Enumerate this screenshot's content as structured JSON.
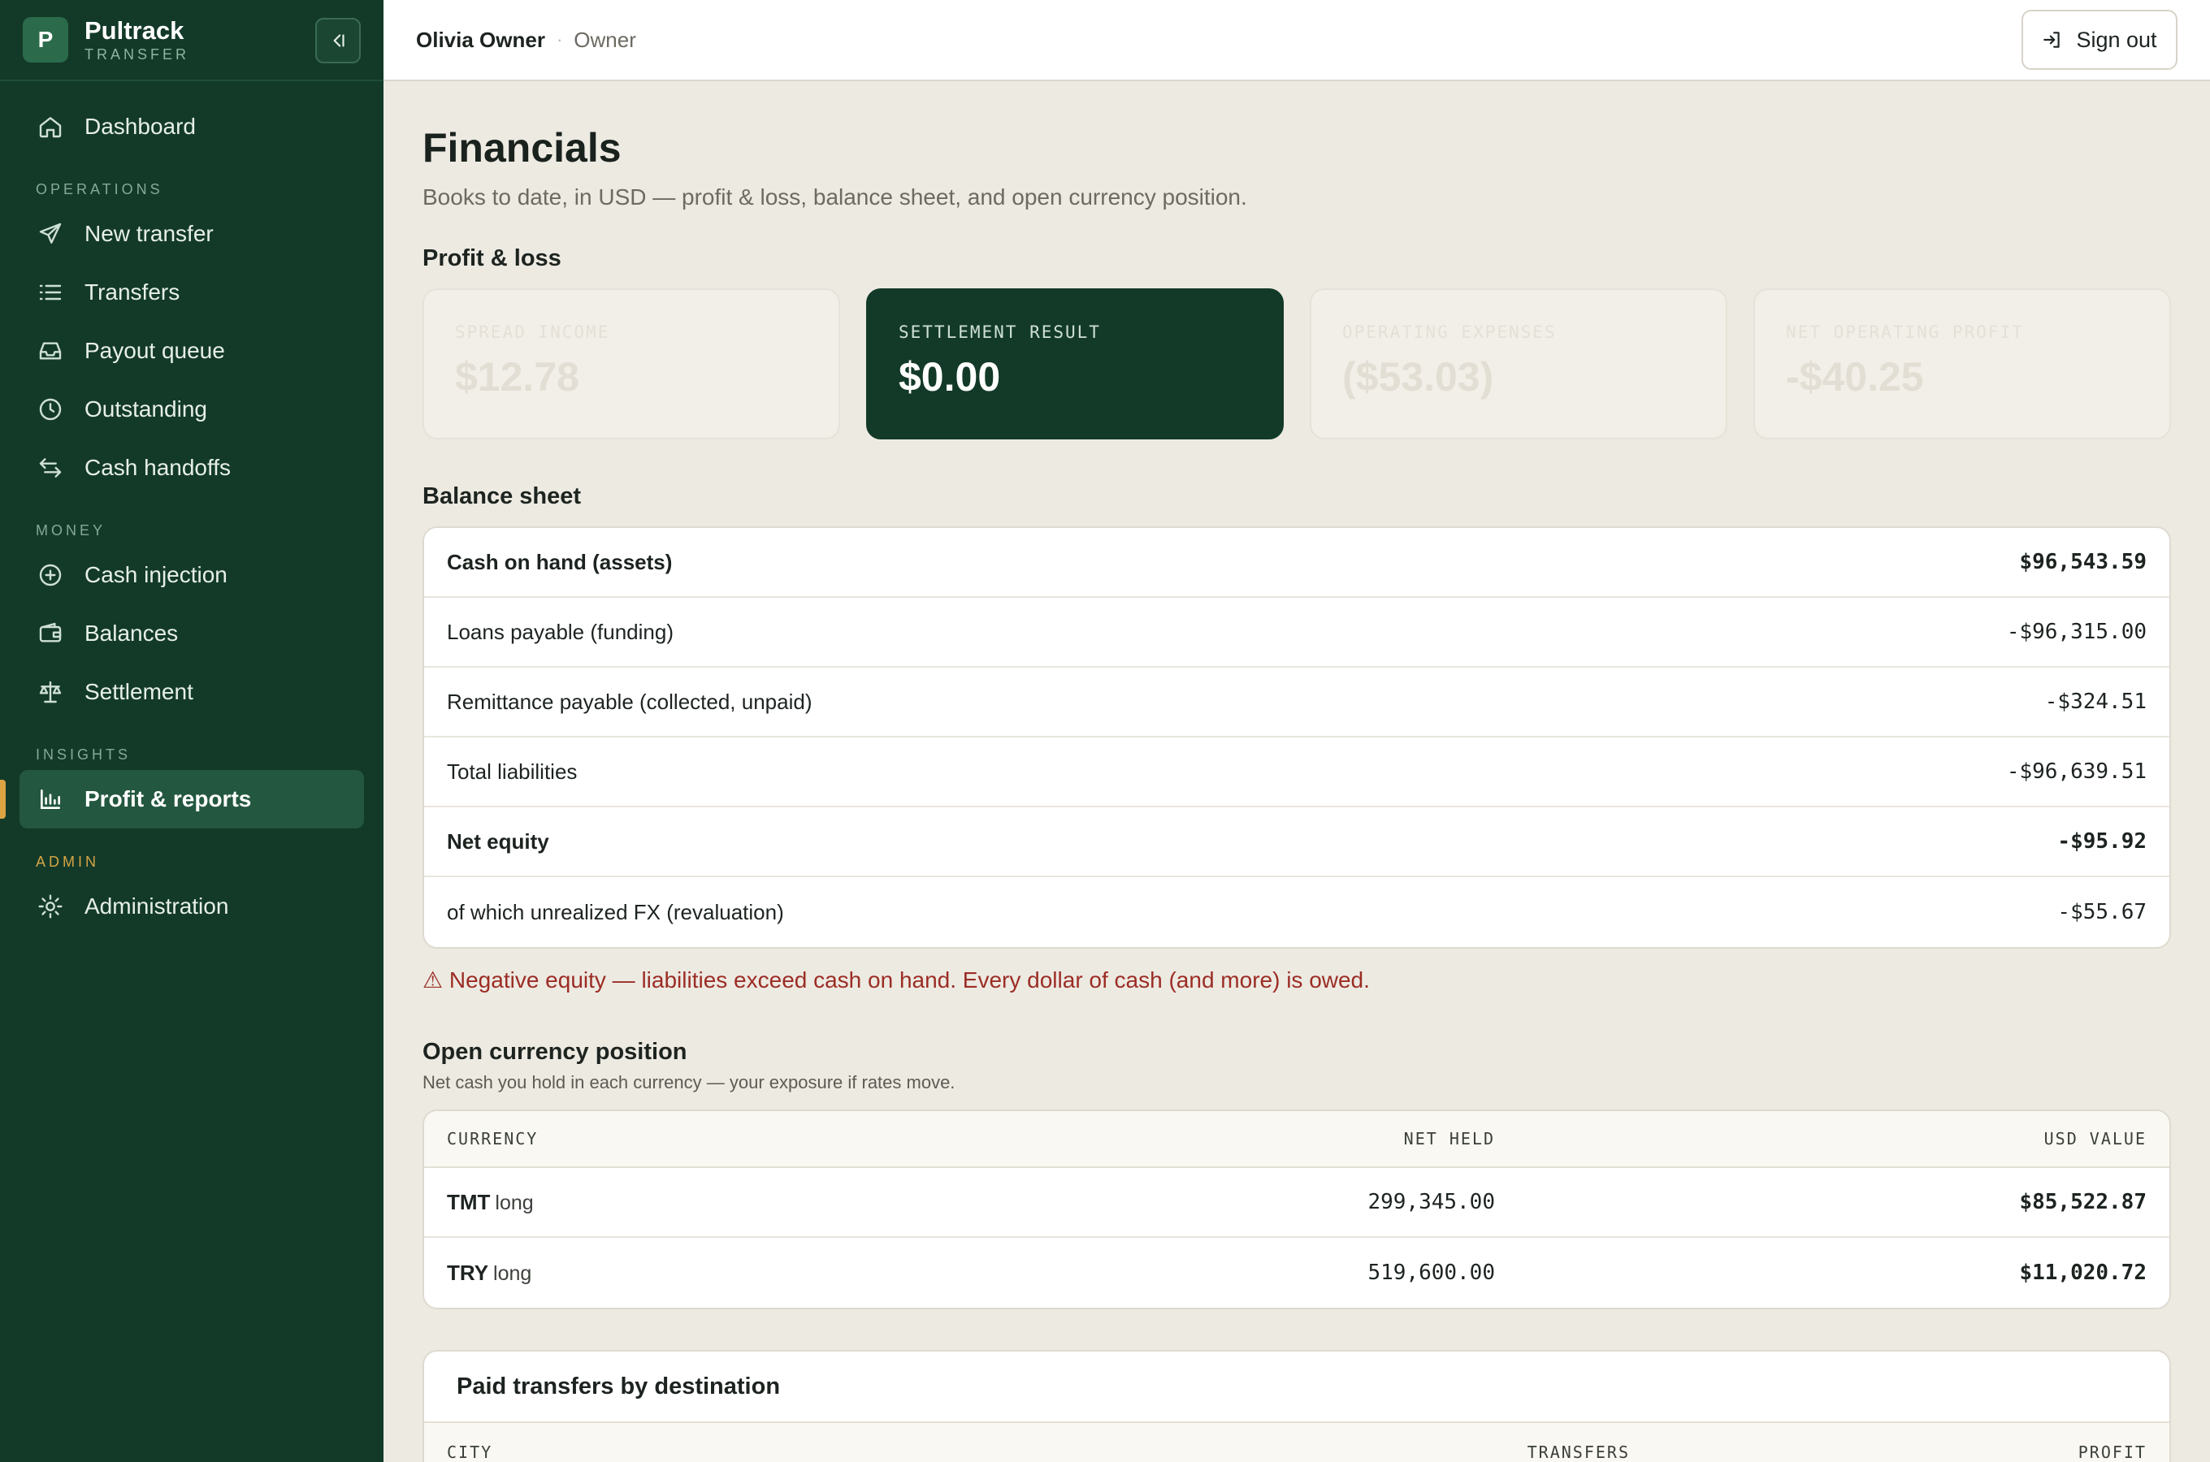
{
  "brand": {
    "logo_letter": "P",
    "name": "Pultrack",
    "sub": "TRANSFER"
  },
  "nav": {
    "dashboard": "Dashboard",
    "sections": {
      "operations": "OPERATIONS",
      "money": "MONEY",
      "insights": "INSIGHTS",
      "admin": "ADMIN"
    },
    "operations": [
      "New transfer",
      "Transfers",
      "Payout queue",
      "Outstanding",
      "Cash handoffs"
    ],
    "money": [
      "Cash injection",
      "Balances",
      "Settlement"
    ],
    "insights": [
      "Profit & reports"
    ],
    "admin": [
      "Administration"
    ]
  },
  "topbar": {
    "user": "Olivia Owner",
    "separator": "·",
    "role": "Owner",
    "signout": "Sign out"
  },
  "page": {
    "title": "Financials",
    "subtitle": "Books to date, in USD — profit & loss, balance sheet, and open currency position."
  },
  "pnl": {
    "title": "Profit & loss",
    "cards": [
      {
        "label": "SPREAD INCOME",
        "value": "$12.78"
      },
      {
        "label": "SETTLEMENT RESULT",
        "value": "$0.00"
      },
      {
        "label": "OPERATING EXPENSES",
        "value": "($53.03)"
      },
      {
        "label": "NET OPERATING PROFIT",
        "value": "-$40.25"
      }
    ]
  },
  "balance_sheet": {
    "title": "Balance sheet",
    "rows": [
      {
        "label": "Cash on hand (assets)",
        "value": "$96,543.59"
      },
      {
        "label": "Loans payable (funding)",
        "value": "-$96,315.00"
      },
      {
        "label": "Remittance payable (collected, unpaid)",
        "value": "-$324.51"
      },
      {
        "label": "Total liabilities",
        "value": "-$96,639.51"
      },
      {
        "label": "Net equity",
        "value": "-$95.92"
      },
      {
        "label": "of which unrealized FX (revaluation)",
        "value": "-$55.67"
      }
    ],
    "warning": "⚠ Negative equity — liabilities exceed cash on hand. Every dollar of cash (and more) is owed."
  },
  "currency_position": {
    "title": "Open currency position",
    "subtitle": "Net cash you hold in each currency — your exposure if rates move.",
    "columns": [
      "CURRENCY",
      "NET HELD",
      "USD VALUE"
    ],
    "rows": [
      {
        "currency": "TMT",
        "direction": "long",
        "net_held": "299,345.00",
        "usd_value": "$85,522.87"
      },
      {
        "currency": "TRY",
        "direction": "long",
        "net_held": "519,600.00",
        "usd_value": "$11,020.72"
      }
    ]
  },
  "paid_transfers": {
    "title": "Paid transfers by destination",
    "columns": [
      "CITY",
      "TRANSFERS",
      "PROFIT"
    ]
  },
  "colors": {
    "sidebar": "#133a29",
    "accent": "#d9a441",
    "warning": "#9b2d25",
    "background": "#edeae2"
  }
}
